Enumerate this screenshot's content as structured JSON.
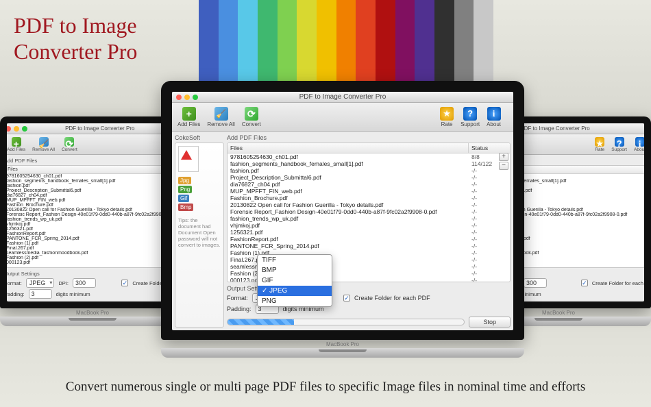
{
  "hero": {
    "line1": "PDF to Image",
    "line2": "Converter Pro"
  },
  "tagline": "Convert numerous single or multi page PDF files to specific Image files in nominal time and efforts",
  "stripe_colors": [
    "#3f5fbf",
    "#4a8fe0",
    "#58c8e8",
    "#3fb86f",
    "#7fd050",
    "#d8d830",
    "#f0c000",
    "#f08000",
    "#e04020",
    "#b01010",
    "#801060",
    "#503090",
    "#303030",
    "#808080",
    "#c8c8c8"
  ],
  "window": {
    "title": "PDF to Image Converter Pro",
    "toolbar": {
      "addFiles": "Add Files",
      "removeAll": "Remove All",
      "convert": "Convert",
      "rate": "Rate",
      "support": "Support",
      "about": "About"
    },
    "sidebar": {
      "title": "CokeSoft",
      "badges": [
        "Jpg",
        "Png",
        "Gif",
        "Bmp"
      ],
      "tip": "Tips: the document had Document Open password will not convert to images."
    },
    "filesGroup": "Add PDF Files",
    "columns": {
      "file": "Files",
      "status": "Status"
    },
    "rows": [
      {
        "file": "9781605254630_ch01.pdf",
        "status": "8/8"
      },
      {
        "file": "fashion_segments_handbook_females_small[1].pdf",
        "status": "114/122"
      },
      {
        "file": "fashion.pdf",
        "status": "-/-"
      },
      {
        "file": "Project_Description_Submittal6.pdf",
        "status": "-/-"
      },
      {
        "file": "dia76827_ch04.pdf",
        "status": "-/-"
      },
      {
        "file": "MUP_MPFFT_FIN_web.pdf",
        "status": "-/-"
      },
      {
        "file": "Fashion_Brochure.pdf",
        "status": "-/-"
      },
      {
        "file": "20130822 Open call for Fashion Guerilla - Tokyo details.pdf",
        "status": "-/-"
      },
      {
        "file": "Forensic Report_Fashion Design-40e01f79-0dd0-440b-a87f-9fc02a2f9908-0.pdf",
        "status": "-/-"
      },
      {
        "file": "fashion_trends_wp_uk.pdf",
        "status": "-/-"
      },
      {
        "file": "vhjmkoj.pdf",
        "status": "-/-"
      },
      {
        "file": "1256321.pdf",
        "status": "-/-"
      },
      {
        "file": "FashionReport.pdf",
        "status": "-/-"
      },
      {
        "file": "PANTONE_FCR_Spring_2014.pdf",
        "status": "-/-"
      },
      {
        "file": "Fashion (1).pdf",
        "status": "-/-"
      },
      {
        "file": "Final.267.pdf",
        "status": "-/-"
      },
      {
        "file": "seamlessmedia_fashionmoodbook.pdf",
        "status": "-/-"
      },
      {
        "file": "Fashion (2).pdf",
        "status": "-/-"
      },
      {
        "file": "000123.pdf",
        "status": "-/-"
      }
    ],
    "output": {
      "group": "Output Settings",
      "formatLabel": "Format:",
      "formatValue": "JPEG",
      "formatOptions": [
        "TIFF",
        "BMP",
        "GIF",
        "JPEG",
        "PNG"
      ],
      "dpiLabel": "DPI:",
      "dpiValue": "300",
      "createFolder": "Create Folder for each PDF",
      "paddingLabel": "Padding:",
      "paddingValue": "3",
      "paddingSuffix": "digits minimum"
    },
    "stop": "Stop",
    "laptopBrand": "MacBook Pro"
  }
}
